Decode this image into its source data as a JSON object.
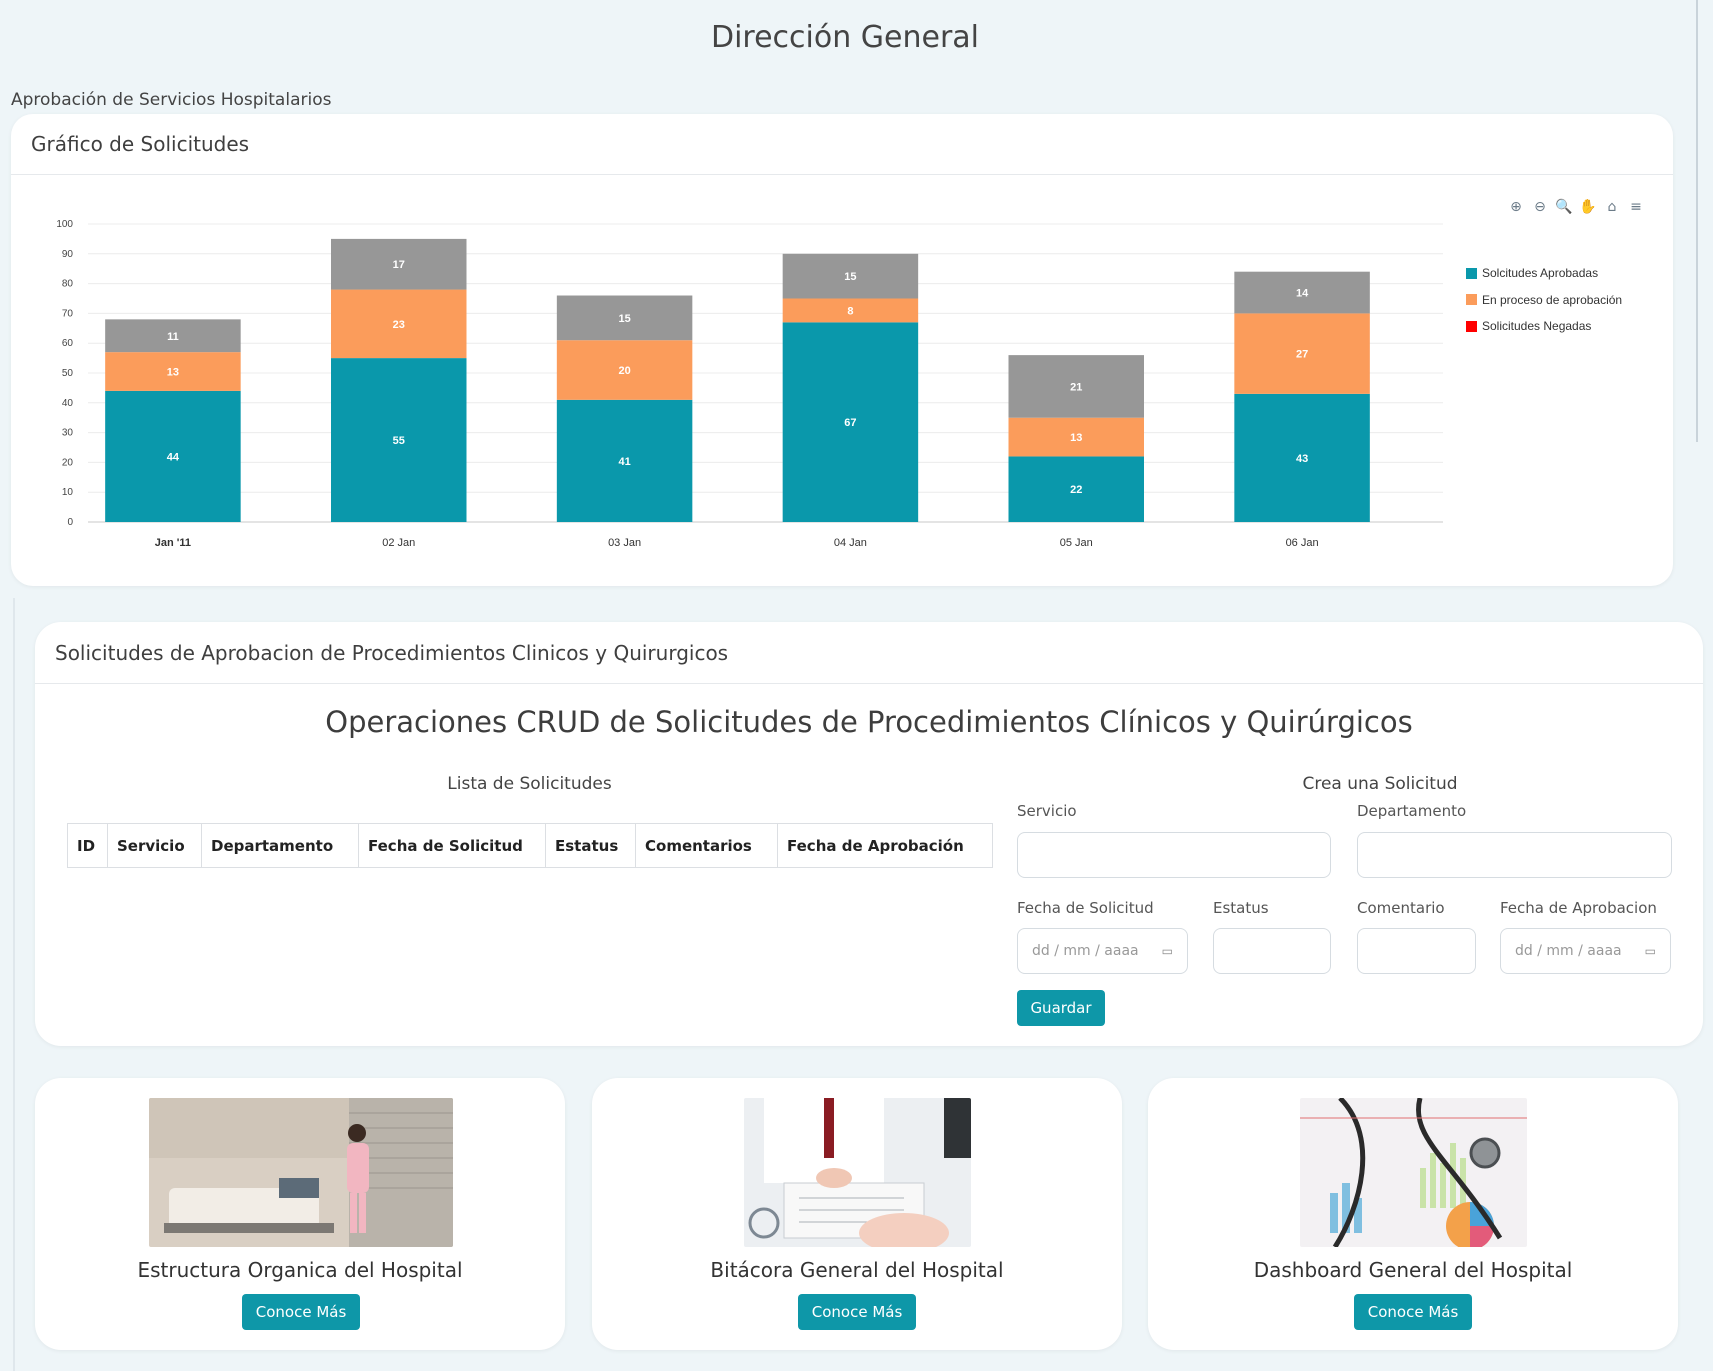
{
  "page": {
    "title": "Dirección General",
    "section_label": "Aprobación de Servicios Hospitalarios"
  },
  "chart_card": {
    "title": "Gráfico de Solicitudes",
    "toolbar": [
      {
        "name": "zoom-in-icon",
        "glyph": "⊕"
      },
      {
        "name": "zoom-out-icon",
        "glyph": "⊖"
      },
      {
        "name": "magnifier-icon",
        "glyph": "🔍"
      },
      {
        "name": "pan-hand-icon",
        "glyph": "✋"
      },
      {
        "name": "home-icon",
        "glyph": "⌂"
      },
      {
        "name": "menu-icon",
        "glyph": "≡"
      }
    ]
  },
  "chart_data": {
    "type": "bar",
    "stacked": true,
    "categories": [
      "Jan '11",
      "02 Jan",
      "03 Jan",
      "04 Jan",
      "05 Jan",
      "06 Jan"
    ],
    "series": [
      {
        "name": "Solcitudes Aprobadas",
        "color": "#0a98ab",
        "values": [
          44,
          55,
          41,
          67,
          22,
          43
        ]
      },
      {
        "name": "En proceso de aprobación",
        "color": "#fb9c5b",
        "values": [
          13,
          23,
          20,
          8,
          13,
          27
        ]
      },
      {
        "name": "Solicitudes Negadas",
        "color": "#ff0000",
        "values": [
          11,
          17,
          15,
          15,
          21,
          14
        ]
      }
    ],
    "stack_top_color": "#979797",
    "ylim": [
      0,
      100
    ],
    "yticks": [
      0,
      10,
      20,
      30,
      40,
      50,
      60,
      70,
      80,
      90,
      100
    ],
    "grid": true,
    "legend_position": "right"
  },
  "crud_card": {
    "header": "Solicitudes de Aprobacion de Procedimientos Clinicos y Quirurgicos",
    "title": "Operaciones CRUD de Solicitudes de Procedimientos Clínicos y Quirúrgicos",
    "list_title": "Lista de Solicitudes",
    "columns": [
      "ID",
      "Servicio",
      "Departamento",
      "Fecha de Solicitud",
      "Estatus",
      "Comentarios",
      "Fecha de Aprobación"
    ],
    "form": {
      "title": "Crea una Solicitud",
      "servicio_label": "Servicio",
      "departamento_label": "Departamento",
      "fecha_solicitud_label": "Fecha de Solicitud",
      "estatus_label": "Estatus",
      "comentario_label": "Comentario",
      "fecha_aprobacion_label": "Fecha de Aprobacion",
      "date_placeholder": "dd / mm / aaaa",
      "save_label": "Guardar"
    }
  },
  "link_cards": [
    {
      "title": "Estructura Organica del Hospital",
      "button": "Conoce Más"
    },
    {
      "title": "Bitácora General del Hospital",
      "button": "Conoce Más"
    },
    {
      "title": "Dashboard General del Hospital",
      "button": "Conoce Más"
    }
  ],
  "colors": {
    "accent": "#0e97a8",
    "background": "#eef5f8"
  }
}
